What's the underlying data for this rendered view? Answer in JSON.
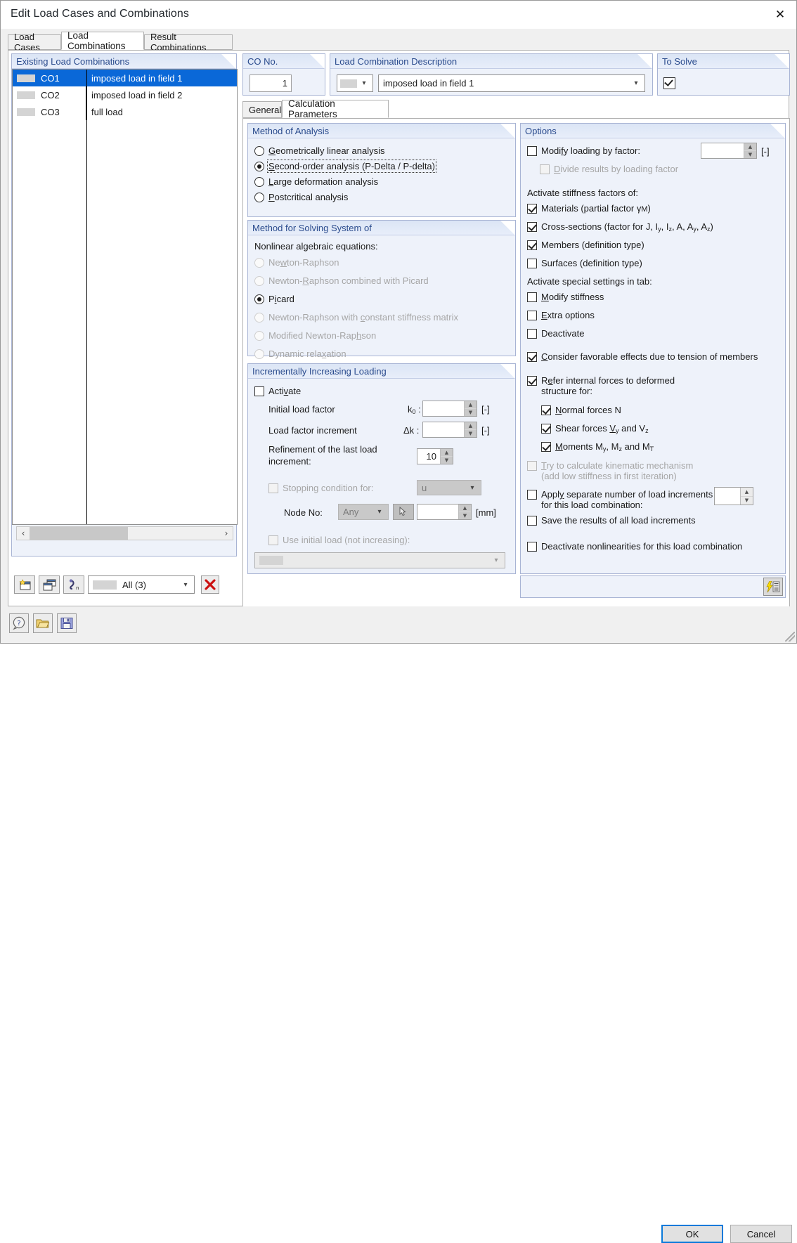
{
  "window": {
    "title": "Edit Load Cases and Combinations",
    "close_icon": "close-icon"
  },
  "tabs": [
    {
      "label": "Load Cases",
      "selected": false
    },
    {
      "label": "Load Combinations",
      "selected": true
    },
    {
      "label": "Result Combinations",
      "selected": false
    }
  ],
  "existing": {
    "caption": "Existing Load Combinations",
    "rows": [
      {
        "no": "CO1",
        "desc": "imposed load in field 1",
        "selected": true
      },
      {
        "no": "CO2",
        "desc": "imposed load in field 2",
        "selected": false
      },
      {
        "no": "CO3",
        "desc": "full load",
        "selected": false
      }
    ],
    "scroll_left": "‹",
    "scroll_right": "›",
    "filter_value": "All (3)",
    "buttons": {
      "new": "new-combination-button",
      "copy": "copy-combination-button",
      "renumber": "renumber-button",
      "delete": "delete-combination-button"
    }
  },
  "co_no": {
    "caption": "CO No.",
    "caption_accel": "N",
    "value": "1"
  },
  "description": {
    "caption": "Load Combination Description",
    "caption_accel": "D",
    "value": "imposed load in field 1"
  },
  "to_solve": {
    "caption": "To Solve",
    "caption_accel": "S",
    "checked": true
  },
  "inner_tabs": [
    {
      "label": "General",
      "selected": false
    },
    {
      "label": "Calculation Parameters",
      "selected": true
    }
  ],
  "method_of_analysis": {
    "caption": "Method of Analysis",
    "options": [
      {
        "label": "Geometrically linear analysis",
        "accel": "G",
        "checked": false,
        "focused": false
      },
      {
        "label": "Second-order analysis (P-Delta / P-delta)",
        "accel": "S",
        "checked": true,
        "focused": true
      },
      {
        "label": "Large deformation analysis",
        "accel": "L",
        "checked": false,
        "focused": false
      },
      {
        "label": "Postcritical analysis",
        "accel": "P",
        "checked": false,
        "focused": false
      }
    ]
  },
  "method_for_solving": {
    "caption": "Method for Solving System of",
    "subcaption": "Nonlinear algebraic equations:",
    "options": [
      {
        "label": "Newton-Raphson",
        "accel": "w",
        "checked": false,
        "disabled": true
      },
      {
        "label": "Newton-Raphson combined with Picard",
        "accel": "R",
        "checked": false,
        "disabled": true
      },
      {
        "label": "Picard",
        "accel": "i",
        "checked": true,
        "disabled": false
      },
      {
        "label": "Newton-Raphson with constant stiffness matrix",
        "accel": "c",
        "checked": false,
        "disabled": true
      },
      {
        "label": "Modified Newton-Raphson",
        "accel": "h",
        "checked": false,
        "disabled": true
      },
      {
        "label": "Dynamic relaxation",
        "accel": "x",
        "checked": false,
        "disabled": true
      }
    ]
  },
  "incremental": {
    "caption": "Incrementally Increasing Loading",
    "activate": {
      "label": "Activate",
      "accel": "v",
      "checked": false
    },
    "initial_load_factor": {
      "label": "Initial load factor",
      "symbol": "k",
      "symbol_sub": "0",
      "value": "",
      "unit": "[-]"
    },
    "load_factor_increment": {
      "label": "Load factor increment",
      "symbol": "Δk",
      "value": "",
      "unit": "[-]"
    },
    "refinement": {
      "label": "Refinement of the last load increment:",
      "value": "10"
    },
    "stopping_condition": {
      "label": "Stopping condition for:",
      "checked": false,
      "value": "u"
    },
    "node_no": {
      "label": "Node No:",
      "value": "Any",
      "pick_icon": "pick-node-icon",
      "limit_value": "",
      "unit": "[mm]"
    },
    "use_initial_load": {
      "label": "Use initial load (not increasing):",
      "checked": false,
      "value": ""
    }
  },
  "options": {
    "caption": "Options",
    "modify_loading": {
      "label": "Modify loading by factor:",
      "accel": "f",
      "checked": false,
      "value": "",
      "unit": "[-]"
    },
    "divide_results": {
      "label": "Divide results by loading factor",
      "accel": "D",
      "checked": false,
      "disabled": true
    },
    "stiffness_header": "Activate stiffness factors of:",
    "stiffness": [
      {
        "label": "Materials (partial factor γM)",
        "checked": true
      },
      {
        "label": "Cross-sections (factor for J, Iy, Iz, A, Ay, Az)",
        "checked": true
      },
      {
        "label": "Members (definition type)",
        "checked": true
      },
      {
        "label": "Surfaces (definition type)",
        "checked": false
      }
    ],
    "special_header": "Activate special settings in tab:",
    "special": [
      {
        "label": "Modify stiffness",
        "accel": "M",
        "checked": false
      },
      {
        "label": "Extra options",
        "accel": "E",
        "checked": false
      },
      {
        "label": "Deactivate",
        "accel": "",
        "checked": false
      }
    ],
    "favorable": {
      "label": "Consider favorable effects due to tension of members",
      "accel": "C",
      "checked": true
    },
    "refer_internal": {
      "label": "Refer internal forces to deformed structure for:",
      "accel": "e",
      "checked": true
    },
    "refer_children": [
      {
        "label": "Normal forces N",
        "accel": "N",
        "checked": true
      },
      {
        "label": "Shear forces Vy and Vz",
        "accel": "V",
        "checked": true
      },
      {
        "label": "Moments My, Mz and MT",
        "accel": "M",
        "checked": true
      }
    ],
    "kinematic": {
      "label": "Try to calculate kinematic mechanism",
      "label2": "(add low stiffness in first iteration)",
      "accel": "T",
      "checked": false,
      "disabled": true
    },
    "separate_increments": {
      "label": "Apply separate number of load increments for this load combination:",
      "accel": "y",
      "checked": false,
      "value": ""
    },
    "save_results": {
      "label": "Save the results of all load increments",
      "checked": false
    },
    "deactivate_nonlin": {
      "label": "Deactivate nonlinearities for this load combination",
      "checked": false
    },
    "settings_icon": "calculation-settings-icon"
  },
  "footer": {
    "help_icon": "help-icon",
    "open_icon": "open-folder-icon",
    "save_icon": "save-icon",
    "ok": "OK",
    "cancel": "Cancel"
  },
  "colors": {
    "selection": "#0a68d8",
    "group_caption_text": "#2a4b8d",
    "accent_button": "#0a7ada"
  }
}
